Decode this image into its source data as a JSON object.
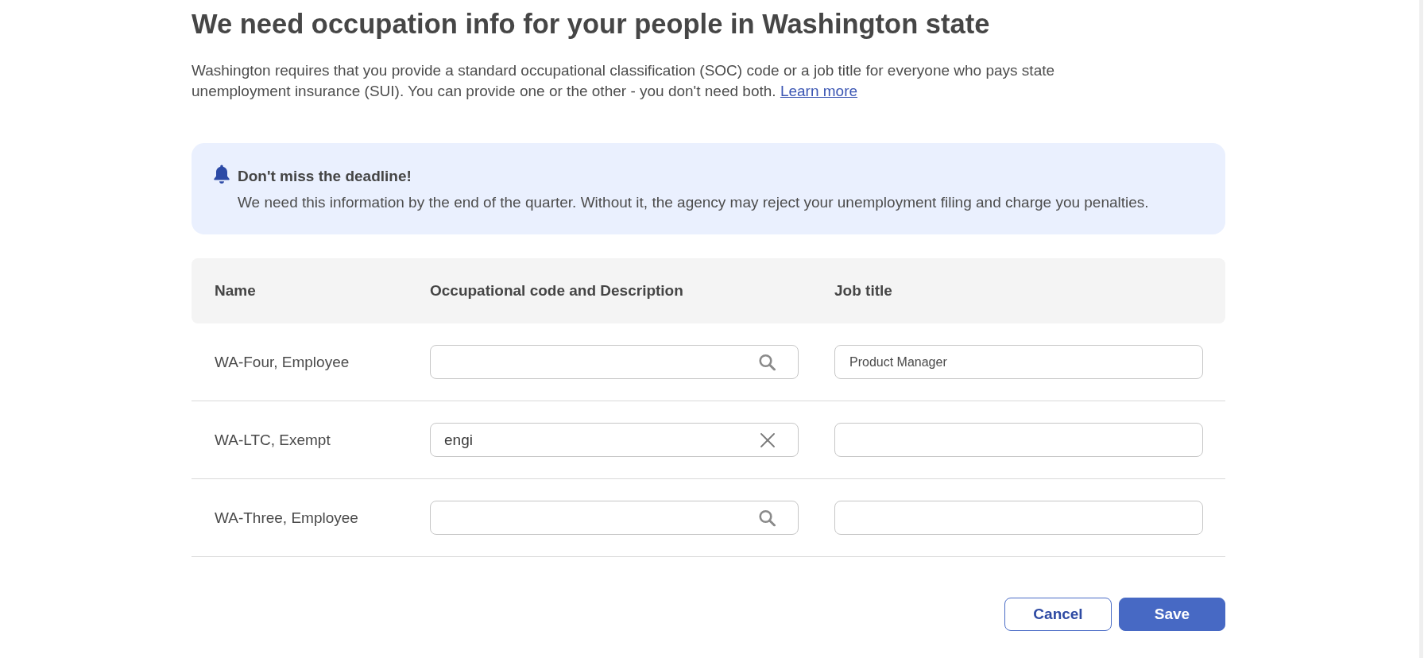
{
  "heading": "We need occupation info for your people in Washington state",
  "intro": {
    "text": "Washington requires that you provide a standard occupational classification (SOC) code or a job title for everyone who pays state unemployment insurance (SUI). You can provide one or the other - you don't need both.",
    "link": "Learn more"
  },
  "alert": {
    "title": "Don't miss the deadline!",
    "message": "We need this information by the end of the quarter. Without it, the agency may reject your unemployment filing and charge you penalties."
  },
  "table": {
    "columns": [
      "Name",
      "Occupational code and Description",
      "Job title"
    ],
    "rows": [
      {
        "name": "WA-Four, Employee",
        "job_title": "Product Manager"
      },
      {
        "name": "WA-LTC, Exempt",
        "occupation": "engi"
      },
      {
        "name": "WA-Three, Employee"
      }
    ]
  },
  "buttons": [
    {
      "label": "Cancel",
      "kind": "secondary"
    },
    {
      "label": "Save",
      "kind": "primary"
    }
  ]
}
